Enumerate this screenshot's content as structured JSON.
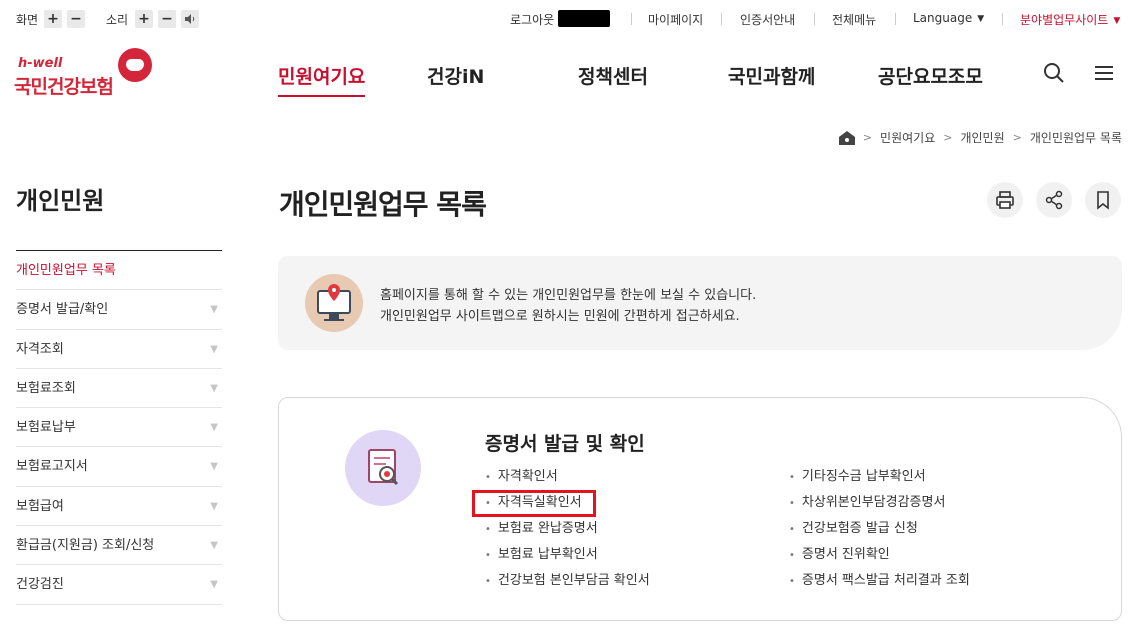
{
  "util": {
    "screen_label": "화면",
    "sound_label": "소리",
    "plus": "+",
    "minus": "−",
    "links": [
      "로그아웃",
      "마이페이지",
      "인증서안내",
      "전체메뉴",
      "Language",
      "분야별업무사이트"
    ]
  },
  "logo": {
    "hwell": "h-well",
    "name": "국민건강보험"
  },
  "gnb": [
    "민원여기요",
    "건강iN",
    "정책센터",
    "국민과함께",
    "공단요모조모"
  ],
  "breadcrumb": [
    "민원여기요",
    "개인민원",
    "개인민원업무 목록"
  ],
  "lnb": {
    "title": "개인민원",
    "items": [
      {
        "label": "개인민원업무 목록",
        "active": true
      },
      {
        "label": "증명서 발급/확인"
      },
      {
        "label": "자격조회"
      },
      {
        "label": "보험료조회"
      },
      {
        "label": "보험료납부"
      },
      {
        "label": "보험료고지서"
      },
      {
        "label": "보험급여"
      },
      {
        "label": "환급금(지원금) 조회/신청"
      },
      {
        "label": "건강검진"
      }
    ]
  },
  "content": {
    "title": "개인민원업무 목록",
    "intro_line1": "홈페이지를 통해 할 수 있는 개인민원업무를 한눈에 보실 수 있습니다.",
    "intro_line2": "개인민원업무 사이트맵으로 원하시는 민원에 간편하게 접근하세요."
  },
  "card": {
    "title": "증명서 발급 및 확인",
    "left": [
      "자격확인서",
      "자격득실확인서",
      "보험료 완납증명서",
      "보험료 납부확인서",
      "건강보험 본인부담금 확인서"
    ],
    "right": [
      "기타징수금 납부확인서",
      "차상위본인부담경감증명서",
      "건강보험증 발급 신청",
      "증명서 진위확인",
      "증명서 팩스발급 처리결과 조회"
    ]
  },
  "colors": {
    "accent": "#c8102e",
    "highlight": "#e3141d"
  }
}
